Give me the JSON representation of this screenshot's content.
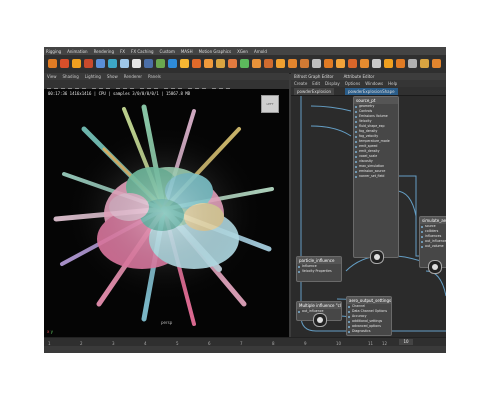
{
  "menu": [
    "Rigging",
    "Animation",
    "Rendering",
    "FX",
    "FX Caching",
    "Custom",
    "MASH",
    "Motion Graphics",
    "XGen",
    "Arnold"
  ],
  "viewport": {
    "menu": [
      "View",
      "Shading",
      "Lighting",
      "Show",
      "Renderer",
      "Panels"
    ],
    "hud": "00:17:36  1416x1416 | CPU | samples 3/0/0/0/0/1 | 15867.8 MB",
    "cube_label": "LEFT",
    "camera_label": "persp",
    "axis_x": "x",
    "axis_y": "y"
  },
  "graph_editor": {
    "title": "Bifrost Graph Editor",
    "title2": "Attribute Editor",
    "menu": [
      "Create",
      "Edit",
      "Display",
      "Options",
      "Windows",
      "Help"
    ],
    "tabs": [
      "powderExplosion",
      "powderExplosionShape"
    ],
    "nodes": [
      {
        "title": "source_pt",
        "rows": [
          "geometry",
          "Controls",
          "Emissions Volume",
          "Velocity",
          "fluid_shape_exp",
          "fog_density",
          "fog_velocity",
          "temperature_mode",
          "emit_speed",
          "emit_density",
          "voxel_scale",
          "viscosity",
          "max_simulation",
          "emission_source",
          "nonrer_set_field"
        ]
      },
      {
        "title": "particle_influence",
        "rows": [
          "Influence",
          "Velocity Properties"
        ]
      },
      {
        "title": "Multiple influence \"cloud_fog_density\"",
        "rows": [
          "out_influence"
        ]
      },
      {
        "title": "simulate_aero",
        "rows": [
          "source",
          "colliders",
          "influences",
          "out_influence",
          "out_volume"
        ]
      },
      {
        "title": "aero_output_settings",
        "rows": [
          "Channel",
          "Data Channel Options",
          "Accuracy",
          "additional_settings",
          "advanced_options",
          "Diagnostics"
        ]
      }
    ]
  },
  "timeline": {
    "ticks": [
      "1",
      "2",
      "3",
      "4",
      "5",
      "6",
      "7",
      "8",
      "9",
      "10",
      "11",
      "12"
    ],
    "current_frame": "10"
  }
}
